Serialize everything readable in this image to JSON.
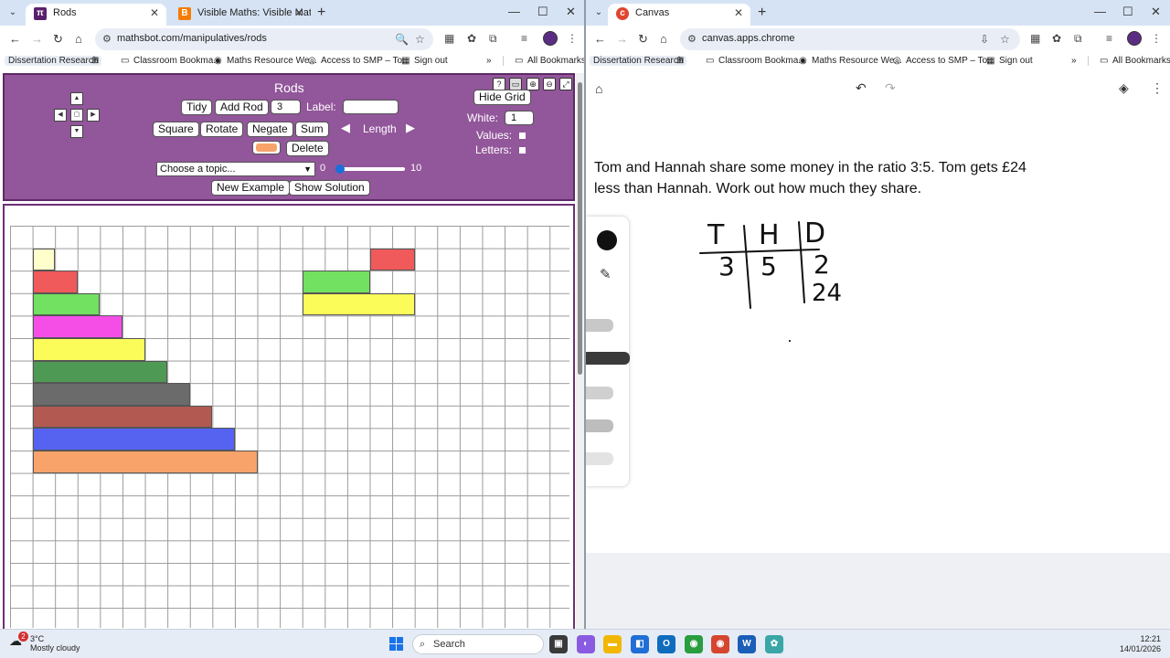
{
  "left_window": {
    "tabs": [
      {
        "title": "Rods",
        "favicon": "π",
        "active": true
      },
      {
        "title": "Visible Maths: Visible Maths Bo",
        "favicon": "B",
        "active": false
      }
    ],
    "url": "mathsbot.com/manipulatives/rods",
    "bookmarks": [
      "Dissertation Research",
      "Classroom Bookma...",
      "Maths Resource We...",
      "Access to SMP – To...",
      "Sign out",
      "All Bookmarks"
    ],
    "rods_app": {
      "title": "Rods",
      "buttons": {
        "tidy": "Tidy",
        "add_rod": "Add Rod",
        "square": "Square",
        "rotate": "Rotate",
        "negate": "Negate",
        "sum": "Sum",
        "delete": "Delete",
        "new_example": "New Example",
        "show_solution": "Show Solution",
        "hide_grid": "Hide Grid"
      },
      "add_rod_value": "3",
      "label_text": "Label:",
      "length_text": "Length",
      "white_text": "White:",
      "white_value": "1",
      "values_text": "Values:",
      "letters_text": "Letters:",
      "topic_placeholder": "Choose a topic...",
      "slider_min": "0",
      "slider_max": "10",
      "selected_colour": "#f7a36a",
      "rod_colours": [
        "#ffffcc",
        "#f05a5a",
        "#72e060",
        "#f54ee6",
        "#fbfb5a",
        "#4e9a55",
        "#6b6b6b",
        "#b25a52",
        "#5563f0",
        "#f7a36a"
      ]
    }
  },
  "right_window": {
    "tabs": [
      {
        "title": "Canvas",
        "favicon": "c",
        "active": true
      }
    ],
    "url": "canvas.apps.chrome",
    "bookmarks": [
      "Dissertation Research",
      "Classroom Bookma...",
      "Maths Resource We...",
      "Access to SMP – To...",
      "Sign out",
      "All Bookmarks"
    ],
    "question_line1": "Tom and Hannah share some money in the ratio 3:5. Tom gets £24",
    "question_line2": "less than Hannah. Work out how much they share.",
    "sketch": {
      "headers": [
        "T",
        "H",
        "D"
      ],
      "row1": [
        "3",
        "5",
        "2"
      ],
      "row2_d": "24"
    }
  },
  "taskbar": {
    "weather_temp": "3°C",
    "weather_desc": "Mostly cloudy",
    "weather_badge": "2",
    "search_placeholder": "Search",
    "time": "12:21",
    "date": "14/01/2026"
  }
}
